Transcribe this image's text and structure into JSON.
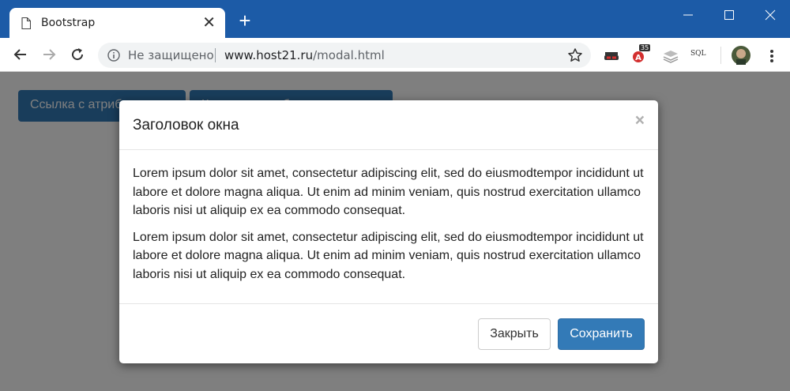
{
  "browser": {
    "tab_title": "Bootstrap",
    "new_tab_glyph": "+",
    "close_glyph": "✕",
    "security_text": "Не защищено",
    "url_host": "www.host21.ru",
    "url_path": "/modal.html",
    "extensions": [
      "incognito-mask-icon",
      "adblock-icon",
      "layers-icon",
      "sql-icon"
    ],
    "sql_label": "SQL",
    "adblock_count": "35",
    "accent_color": "#1c5ba7"
  },
  "page": {
    "buttons": [
      {
        "label": "Ссылка с атрибутами"
      },
      {
        "label": "Кнопка с атрибутами"
      }
    ]
  },
  "modal": {
    "title": "Заголовок окна",
    "close_glyph": "×",
    "paragraphs": [
      "Lorem ipsum dolor sit amet, consectetur adipiscing elit, sed do eiusmodtempor incididunt ut labore et dolore magna aliqua. Ut enim ad minim veniam, quis nostrud exercitation ullamco laboris nisi ut aliquip ex ea commodo consequat.",
      "Lorem ipsum dolor sit amet, consectetur adipiscing elit, sed do eiusmodtempor incididunt ut labore et dolore magna aliqua. Ut enim ad minim veniam, quis nostrud exercitation ullamco laboris nisi ut aliquip ex ea commodo consequat."
    ],
    "close_label": "Закрыть",
    "save_label": "Сохранить",
    "primary_color": "#337ab7"
  }
}
